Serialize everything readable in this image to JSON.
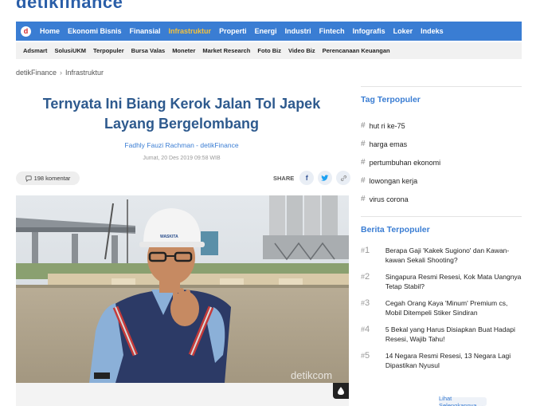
{
  "brand": {
    "logo_text": "detikfinance",
    "logo_letter": "d"
  },
  "mainnav": {
    "items": [
      {
        "label": "Home",
        "active": false
      },
      {
        "label": "Ekonomi Bisnis",
        "active": false
      },
      {
        "label": "Finansial",
        "active": false
      },
      {
        "label": "Infrastruktur",
        "active": true
      },
      {
        "label": "Properti",
        "active": false
      },
      {
        "label": "Energi",
        "active": false
      },
      {
        "label": "Industri",
        "active": false
      },
      {
        "label": "Fintech",
        "active": false
      },
      {
        "label": "Infografis",
        "active": false
      },
      {
        "label": "Loker",
        "active": false
      },
      {
        "label": "Indeks",
        "active": false
      }
    ],
    "bg_color": "#3a7dd3",
    "active_color": "#f5c23c"
  },
  "subnav": {
    "items": [
      "Adsmart",
      "SolusiUKM",
      "Terpopuler",
      "Bursa Valas",
      "Moneter",
      "Market Research",
      "Foto Biz",
      "Video Biz",
      "Perencanaan Keuangan"
    ]
  },
  "breadcrumb": {
    "home": "detikFinance",
    "separator": "›",
    "current": "Infrastruktur"
  },
  "article": {
    "title": "Ternyata Ini Biang Kerok Jalan Tol Japek Layang Bergelombang",
    "author": "Fadhly Fauzi Rachman - detikFinance",
    "date": "Jumat, 20 Des 2019 09:58 WIB",
    "comments": "198 komentar",
    "share_label": "SHARE",
    "photo_watermark": "detikcom",
    "helmet_text": "WASKITA"
  },
  "sidebar": {
    "tag_title": "Tag Terpopuler",
    "tags": [
      "hut ri ke-75",
      "harga emas",
      "pertumbuhan ekonomi",
      "lowongan kerja",
      "virus corona"
    ],
    "berita_title": "Berita Terpopuler",
    "berita": [
      {
        "rank": "1",
        "title": "Berapa Gaji 'Kakek Sugiono' dan Kawan-kawan Sekali Shooting?"
      },
      {
        "rank": "2",
        "title": "Singapura Resmi Resesi, Kok Mata Uangnya Tetap Stabil?"
      },
      {
        "rank": "3",
        "title": "Cegah Orang Kaya 'Minum' Premium cs, Mobil Ditempeli Stiker Sindiran"
      },
      {
        "rank": "4",
        "title": "5 Bekal yang Harus Disiapkan Buat Hadapi Resesi, Wajib Tahu!"
      },
      {
        "rank": "5",
        "title": "14 Negara Resmi Resesi, 13 Negara Lagi Dipastikan Nyusul"
      }
    ],
    "more_label": "Lihat Selengkapnya →"
  }
}
